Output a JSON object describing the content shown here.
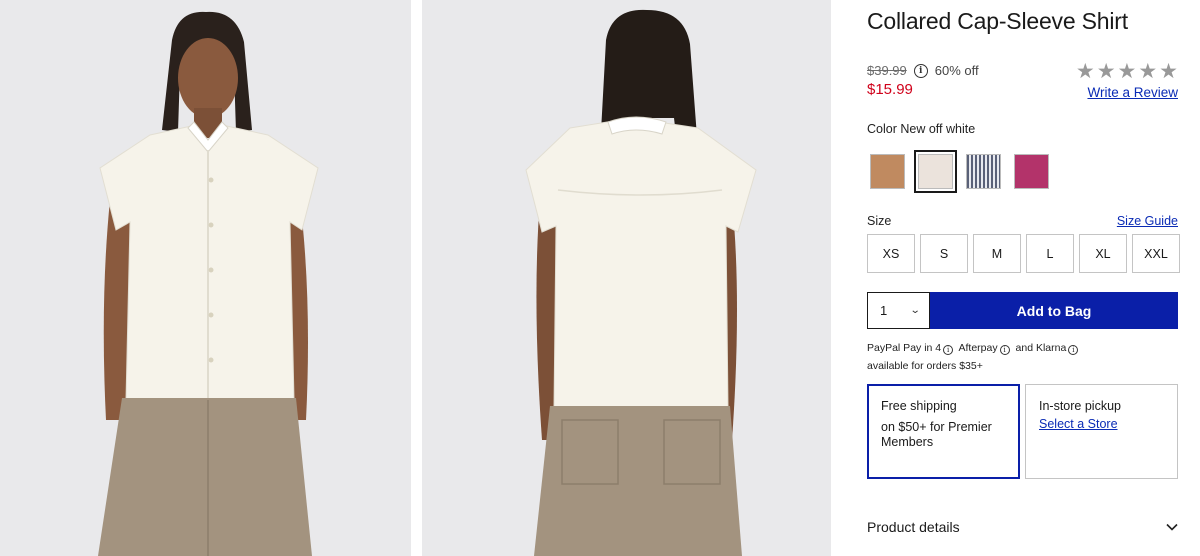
{
  "product": {
    "title": "Collared Cap-Sleeve Shirt",
    "original_price": "$39.99",
    "discount": "60% off",
    "sale_price": "$15.99",
    "rating_stars": 5,
    "rating_filled": 0,
    "write_review": "Write a Review"
  },
  "color": {
    "label": "Color",
    "selected": "New off white",
    "swatches": [
      {
        "name": "tan",
        "hex": "#c08a60"
      },
      {
        "name": "new-off-white",
        "hex": "#ebe3dc",
        "selected": true
      },
      {
        "name": "blue-stripe",
        "hex": "#5a6178"
      },
      {
        "name": "magenta",
        "hex": "#b3336a"
      }
    ]
  },
  "size": {
    "label": "Size",
    "guide": "Size Guide",
    "options": [
      "XS",
      "S",
      "M",
      "L",
      "XL",
      "XXL"
    ]
  },
  "purchase": {
    "quantity": "1",
    "add_to_bag": "Add to Bag"
  },
  "paylater": {
    "paypal": "PayPal Pay in 4",
    "afterpay": "Afterpay",
    "and": "and",
    "klarna": "Klarna",
    "availability": "available for orders $35+"
  },
  "fulfillment": {
    "shipping_title": "Free shipping",
    "shipping_detail": "on $50+ for Premier Members",
    "pickup_title": "In-store pickup",
    "pickup_link": "Select a Store"
  },
  "details": {
    "label": "Product details"
  },
  "colors": {
    "accent_blue": "#0a1fa8",
    "link_blue": "#0a2bb5",
    "sale_red": "#d0021b",
    "photo_bg": "#e9e9eb"
  }
}
